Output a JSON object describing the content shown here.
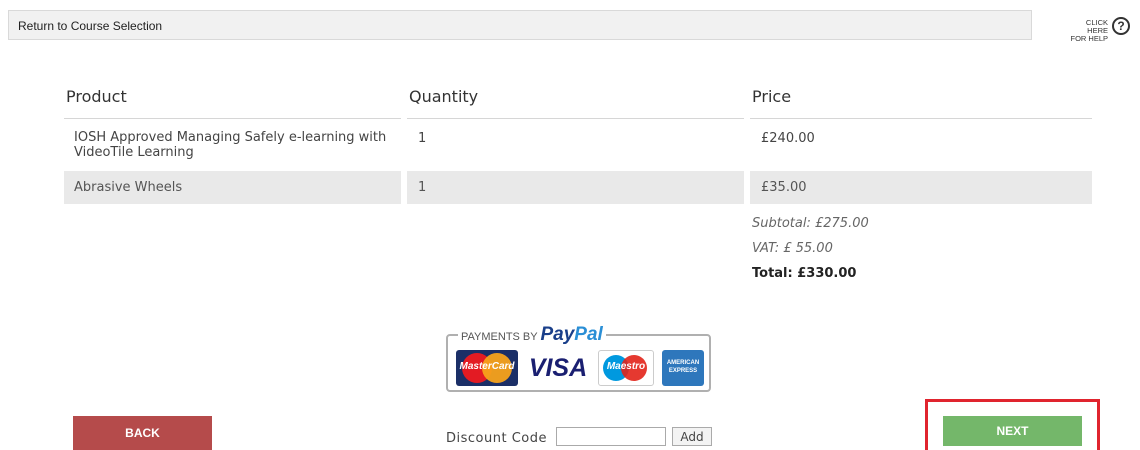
{
  "topbar": {
    "return_label": "Return to Course Selection",
    "help_line1": "CLICK HERE",
    "help_line2": "FOR HELP",
    "help_icon_glyph": "?"
  },
  "table": {
    "columns": [
      "Product",
      "Quantity",
      "Price"
    ],
    "rows": [
      {
        "product": "IOSH Approved Managing Safely e-learning with VideoTile Learning",
        "quantity": "1",
        "price": "£240.00"
      },
      {
        "product": "Abrasive Wheels",
        "quantity": "1",
        "price": "£35.00"
      }
    ]
  },
  "summary": {
    "subtotal": "Subtotal: £275.00",
    "vat": "VAT: £ 55.00",
    "total": "Total: £330.00"
  },
  "payments": {
    "label": "PAYMENTS BY",
    "brand_part1": "Pay",
    "brand_part2": "Pal",
    "cards": [
      "MasterCard",
      "VISA",
      "Maestro",
      "AMERICAN EXPRESS"
    ]
  },
  "actions": {
    "back_label": "BACK",
    "next_label": "NEXT"
  },
  "discount": {
    "label": "Discount Code",
    "value": "",
    "add_label": "Add"
  },
  "colors": {
    "back_button": "#b54b4b",
    "next_button": "#74b76a",
    "highlight_border": "#e0242e",
    "paypal_dark": "#1a3f8a",
    "paypal_light": "#2a8fd6"
  }
}
